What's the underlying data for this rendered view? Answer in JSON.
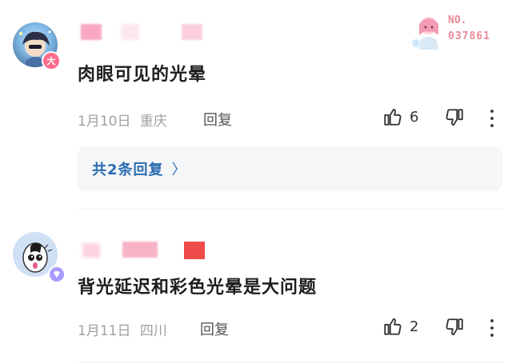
{
  "comments": [
    {
      "text": "肉眼可见的光晕",
      "date": "1月10日",
      "location": "重庆",
      "reply_label": "回复",
      "likes": "6",
      "badge_label": "大",
      "medal": {
        "no_label": "NO.",
        "number": "037861"
      },
      "replies_summary": "共2条回复",
      "replies_chevron": "〉"
    },
    {
      "text": "背光延迟和彩色光晕是大问题",
      "date": "1月11日",
      "location": "四川",
      "reply_label": "回复",
      "likes": "2"
    }
  ],
  "colors": {
    "link_blue": "#2b6cb0",
    "meta_gray": "#a0a0a0",
    "name_blur_pink": "#f8a8c0",
    "name_blur_red": "#ef4b4b"
  },
  "icons": [
    "thumbs-up-icon",
    "thumbs-down-icon",
    "more-vertical-icon",
    "chevron-right-icon"
  ]
}
